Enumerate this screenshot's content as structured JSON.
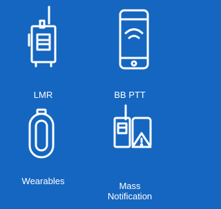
{
  "colors": {
    "background": "#1566c0",
    "foreground": "#ffffff"
  },
  "tiles": [
    {
      "id": "lmr",
      "label": "LMR",
      "icon": "two-way-radio-icon"
    },
    {
      "id": "bb-ptt",
      "label": "BB PTT",
      "icon": "smartphone-wifi-icon"
    },
    {
      "id": "wearables",
      "label": "Wearables",
      "icon": "wearable-device-icon"
    },
    {
      "id": "mass-notification",
      "label_line1": "Mass",
      "label_line2": "Notification",
      "icon": "radio-phone-alert-icon"
    }
  ]
}
